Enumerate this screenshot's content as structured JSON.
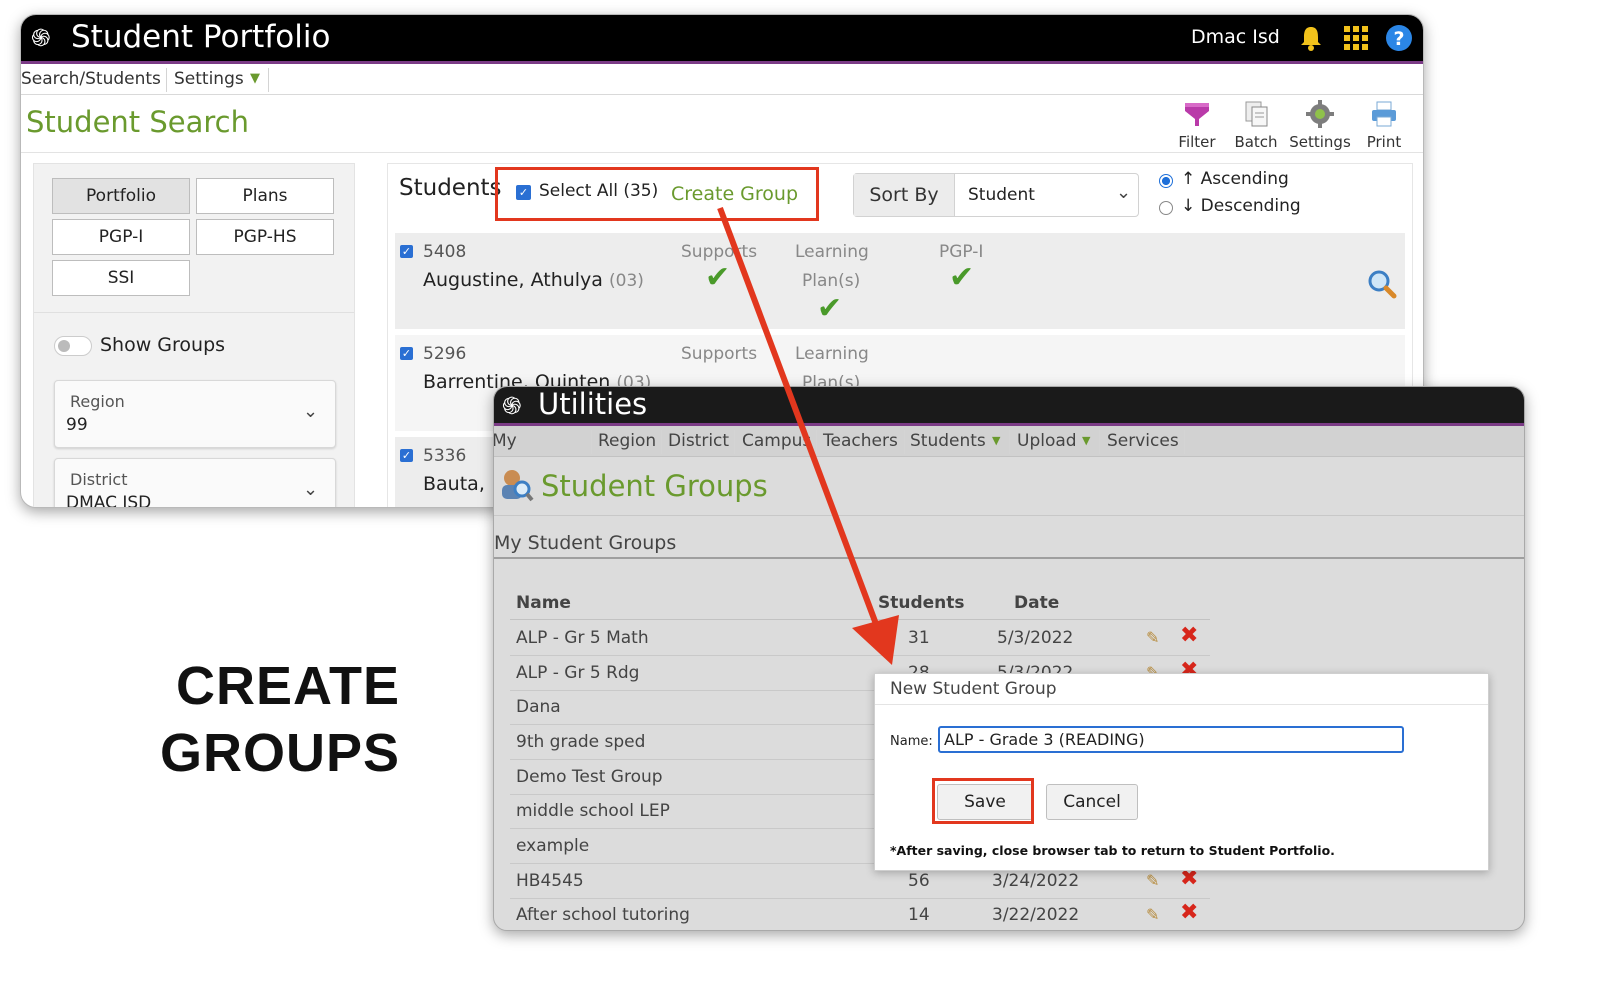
{
  "portfolio": {
    "title": "Student Portfolio",
    "user": "Dmac Isd",
    "menu": {
      "search": "Search/Students",
      "settings": "Settings"
    },
    "page_title": "Student Search",
    "toolbar": {
      "filter": "Filter",
      "batch": "Batch",
      "settings": "Settings",
      "print": "Print"
    },
    "tabs": [
      "Portfolio",
      "Plans",
      "PGP-I",
      "PGP-HS",
      "SSI"
    ],
    "show_groups": "Show Groups",
    "region": {
      "label": "Region",
      "value": "99"
    },
    "district": {
      "label": "District",
      "value": "DMAC ISD"
    },
    "students_label": "Students",
    "select_all": "Select All (35)",
    "create_group": "Create Group",
    "sort_by": "Sort By",
    "sort_value": "Student",
    "ascending": "Ascending",
    "descending": "Descending",
    "columns": {
      "supports": "Supports",
      "learning": "Learning",
      "plans": "Plan(s)",
      "pgpi": "PGP-I"
    },
    "students": [
      {
        "id": "5408",
        "name": "Augustine, Athulya",
        "grade": "(03)"
      },
      {
        "id": "5296",
        "name": "Barrentine, Quinten",
        "grade": "(03)"
      },
      {
        "id": "5336",
        "name": "Bauta,",
        "grade": ""
      }
    ]
  },
  "utilities": {
    "title": "Utilities",
    "menu": [
      "My Account",
      "Region",
      "District",
      "Campus",
      "Teachers",
      "Students",
      "Upload",
      "Services"
    ],
    "page_title": "Student Groups",
    "section": "My Student Groups",
    "headers": {
      "name": "Name",
      "students": "Students",
      "date": "Date"
    },
    "groups": [
      {
        "name": "ALP - Gr 5 Math",
        "students": "31",
        "date": "5/3/2022"
      },
      {
        "name": "ALP - Gr 5 Rdg",
        "students": "28",
        "date": "5/3/2022"
      },
      {
        "name": "Dana",
        "students": "",
        "date": ""
      },
      {
        "name": "9th grade sped",
        "students": "",
        "date": ""
      },
      {
        "name": "Demo Test Group",
        "students": "",
        "date": ""
      },
      {
        "name": "middle school LEP",
        "students": "",
        "date": ""
      },
      {
        "name": "example",
        "students": "",
        "date": ""
      },
      {
        "name": "HB4545",
        "students": "56",
        "date": "3/24/2022"
      },
      {
        "name": "After school tutoring",
        "students": "14",
        "date": "3/22/2022"
      }
    ]
  },
  "modal": {
    "title": "New Student Group",
    "name_label": "Name:",
    "name_value": "ALP - Grade 3 (READING)",
    "save": "Save",
    "cancel": "Cancel",
    "note": "*After saving, close browser tab to return to Student Portfolio."
  },
  "caption": {
    "line1": "CREATE",
    "line2": "GROUPS"
  },
  "colors": {
    "accent_green": "#6a9a2e",
    "highlight_red": "#e2371e",
    "title_bar": "#000000",
    "purple_rule": "#7b3b86"
  }
}
